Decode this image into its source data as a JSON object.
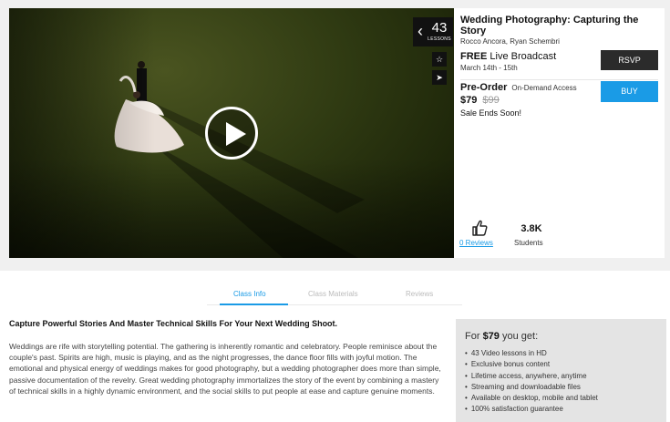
{
  "video": {
    "lessons_count": "43",
    "lessons_label": "LESSONS"
  },
  "course": {
    "title": "Wedding Photography: Capturing the Story",
    "instructors": "Rocco Ancora, Ryan Schembri"
  },
  "broadcast": {
    "free_label": "FREE",
    "live_label": "Live Broadcast",
    "dates": "March 14th - 15th",
    "rsvp_label": "RSVP"
  },
  "purchase": {
    "preorder_label": "Pre-Order",
    "ondemand_label": "On-Demand Access",
    "price": "$79",
    "old_price": "$99",
    "sale_text": "Sale Ends Soon!",
    "buy_label": "BUY"
  },
  "stats": {
    "reviews": "0 Reviews",
    "students_count": "3.8K",
    "students_label": "Students"
  },
  "tabs": [
    {
      "label": "Class Info",
      "active": true
    },
    {
      "label": "Class Materials",
      "active": false
    },
    {
      "label": "Reviews",
      "active": false
    }
  ],
  "content": {
    "headline": "Capture Powerful Stories And Master Technical Skills For Your Next Wedding Shoot.",
    "body": "Weddings are rife with storytelling potential. The gathering is inherently romantic and celebratory. People reminisce about the couple's past. Spirits are high, music is playing, and as the night progresses, the dance floor fills with joyful motion. The emotional and physical energy of weddings makes for good photography, but a wedding photographer does more than simple, passive documentation of the revelry. Great wedding photography immortalizes the story of the event by combining a mastery of technical skills in a highly dynamic environment, and the social skills to put people at ease and capture genuine moments."
  },
  "includes": {
    "title_prefix": "For",
    "title_price": "$79",
    "title_suffix": "you get:",
    "items": [
      "43 Video lessons in HD",
      "Exclusive bonus content",
      "Lifetime access, anywhere, anytime",
      "Streaming and downloadable files",
      "Available on desktop, mobile and tablet",
      "100% satisfaction guarantee"
    ]
  },
  "colors": {
    "accent": "#1a9be6",
    "dark_button": "#2b2b2b",
    "panel_background": "#f0f0f0"
  },
  "icons": [
    "play-icon",
    "chevron-left-icon",
    "star-icon",
    "share-icon",
    "thumbs-up-icon"
  ]
}
